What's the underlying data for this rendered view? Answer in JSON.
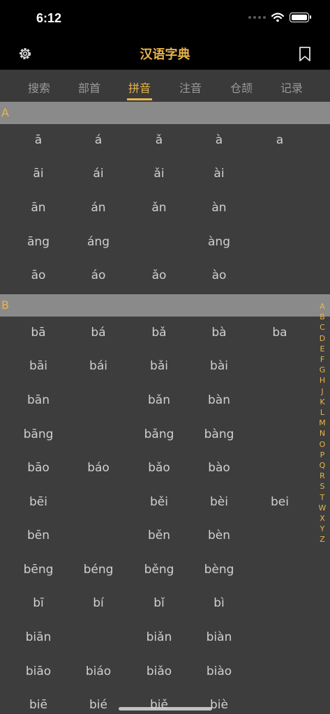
{
  "status": {
    "time": "6:12"
  },
  "nav": {
    "title": "汉语字典"
  },
  "tabs": [
    {
      "label": "搜索"
    },
    {
      "label": "部首"
    },
    {
      "label": "拼音"
    },
    {
      "label": "注音"
    },
    {
      "label": "仓颉"
    },
    {
      "label": "记录"
    }
  ],
  "active_tab": "拼音",
  "sections": [
    {
      "letter": "A",
      "rows": [
        [
          "ā",
          "á",
          "ǎ",
          "à",
          "a"
        ],
        [
          "āi",
          "ái",
          "ǎi",
          "ài",
          ""
        ],
        [
          "ān",
          "án",
          "ǎn",
          "àn",
          ""
        ],
        [
          "āng",
          "áng",
          "",
          "àng",
          ""
        ],
        [
          "āo",
          "áo",
          "ǎo",
          "ào",
          ""
        ]
      ]
    },
    {
      "letter": "B",
      "rows": [
        [
          "bā",
          "bá",
          "bǎ",
          "bà",
          "ba"
        ],
        [
          "bāi",
          "bái",
          "bǎi",
          "bài",
          ""
        ],
        [
          "bān",
          "",
          "bǎn",
          "bàn",
          ""
        ],
        [
          "bāng",
          "",
          "bǎng",
          "bàng",
          ""
        ],
        [
          "bāo",
          "báo",
          "bǎo",
          "bào",
          ""
        ],
        [
          "bēi",
          "",
          "běi",
          "bèi",
          "bei"
        ],
        [
          "bēn",
          "",
          "běn",
          "bèn",
          ""
        ],
        [
          "bēng",
          "béng",
          "běng",
          "bèng",
          ""
        ],
        [
          "bī",
          "bí",
          "bǐ",
          "bì",
          ""
        ],
        [
          "biān",
          "",
          "biǎn",
          "biàn",
          ""
        ],
        [
          "biāo",
          "biáo",
          "biǎo",
          "biào",
          ""
        ],
        [
          "biē",
          "bié",
          "biě",
          "biè",
          ""
        ]
      ]
    }
  ],
  "index_letters": [
    "A",
    "B",
    "C",
    "D",
    "E",
    "F",
    "G",
    "H",
    "J",
    "K",
    "L",
    "M",
    "N",
    "O",
    "P",
    "Q",
    "R",
    "S",
    "T",
    "W",
    "X",
    "Y",
    "Z"
  ],
  "colors": {
    "accent": "#e8b44b",
    "background": "#3d3d3d",
    "header": "#8a8a8a"
  }
}
